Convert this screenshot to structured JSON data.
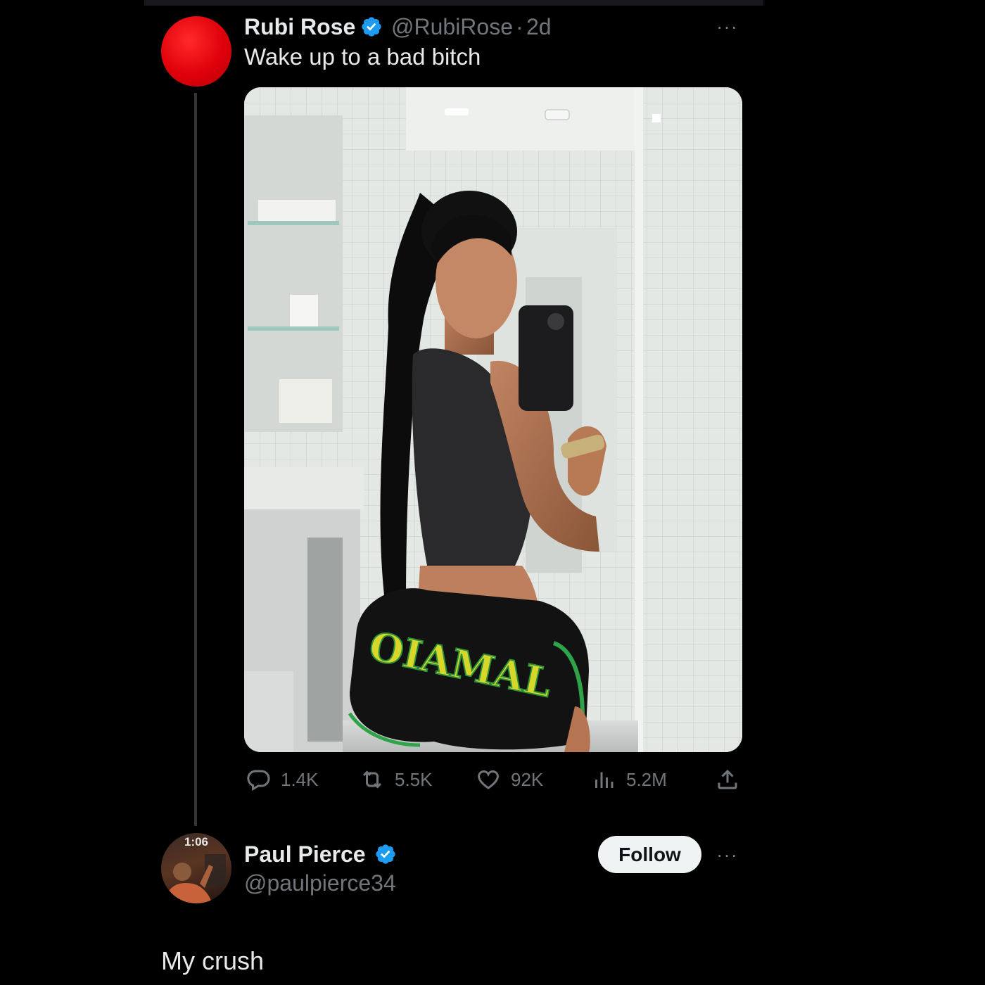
{
  "tweet": {
    "author_name": "Rubi Rose",
    "author_handle": "@RubiRose",
    "separator": "·",
    "time": "2d",
    "text": "Wake up to a bad bitch",
    "more_label": "···",
    "media_text": "OIAMAL",
    "actions": {
      "replies": "1.4K",
      "retweets": "5.5K",
      "likes": "92K",
      "views": "5.2M"
    }
  },
  "reply_user": {
    "name": "Paul Pierce",
    "handle": "@paulpierce34",
    "avatar_clock": "1:06",
    "follow_label": "Follow",
    "more_label": "···"
  },
  "reply_text": "My crush",
  "colors": {
    "background": "#000000",
    "verified": "#1d9bf0",
    "secondary_text": "#71767b",
    "primary_text": "#e7e9ea",
    "follow_bg": "#eff3f4"
  },
  "icons": [
    "verified-badge-icon",
    "reply-icon",
    "retweet-icon",
    "like-icon",
    "views-icon",
    "share-icon",
    "more-icon"
  ]
}
